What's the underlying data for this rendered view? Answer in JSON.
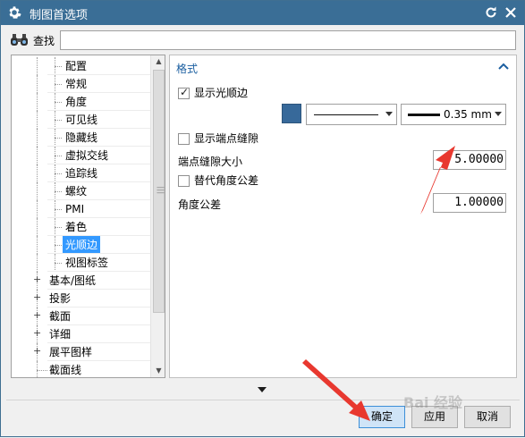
{
  "window": {
    "title": "制图首选项",
    "icon": "gear-icon",
    "title_bar_color": "#3a6e96"
  },
  "search": {
    "label": "查找",
    "value": "",
    "icon": "binoculars-icon"
  },
  "tree": {
    "items": [
      {
        "label": "配置",
        "level": 2,
        "expandable": false,
        "selected": false
      },
      {
        "label": "常规",
        "level": 2,
        "expandable": false,
        "selected": false
      },
      {
        "label": "角度",
        "level": 2,
        "expandable": false,
        "selected": false
      },
      {
        "label": "可见线",
        "level": 2,
        "expandable": false,
        "selected": false
      },
      {
        "label": "隐藏线",
        "level": 2,
        "expandable": false,
        "selected": false
      },
      {
        "label": "虚拟交线",
        "level": 2,
        "expandable": false,
        "selected": false
      },
      {
        "label": "追踪线",
        "level": 2,
        "expandable": false,
        "selected": false
      },
      {
        "label": "螺纹",
        "level": 2,
        "expandable": false,
        "selected": false
      },
      {
        "label": "PMI",
        "level": 2,
        "expandable": false,
        "selected": false
      },
      {
        "label": "着色",
        "level": 2,
        "expandable": false,
        "selected": false
      },
      {
        "label": "光顺边",
        "level": 2,
        "expandable": false,
        "selected": true
      },
      {
        "label": "视图标签",
        "level": 2,
        "expandable": false,
        "selected": false
      },
      {
        "label": "基本/图纸",
        "level": 1,
        "expandable": true,
        "selected": false
      },
      {
        "label": "投影",
        "level": 1,
        "expandable": true,
        "selected": false
      },
      {
        "label": "截面",
        "level": 1,
        "expandable": true,
        "selected": false
      },
      {
        "label": "详细",
        "level": 1,
        "expandable": true,
        "selected": false
      },
      {
        "label": "展平图样",
        "level": 1,
        "expandable": true,
        "selected": false
      },
      {
        "label": "截面线",
        "level": 1,
        "expandable": false,
        "selected": false
      }
    ],
    "selected_color": "#3399ff"
  },
  "format_section": {
    "title": "格式",
    "title_color": "#1a5ea0",
    "show_smooth_edges": {
      "label": "显示光顺边",
      "checked": true
    },
    "line_color": "#37699a",
    "line_width": "0.35 mm",
    "show_endpoint_gap": {
      "label": "显示端点缝隙",
      "checked": false
    },
    "endpoint_gap_size": {
      "label": "端点缝隙大小",
      "value": "5.00000"
    },
    "alt_angle_tolerance": {
      "label": "替代角度公差",
      "checked": false
    },
    "angle_tolerance": {
      "label": "角度公差",
      "value": "1.00000"
    }
  },
  "buttons": {
    "ok": "确定",
    "apply": "应用",
    "cancel": "取消"
  },
  "annotation_color": "#e8382f",
  "watermark": "Bai 经验"
}
